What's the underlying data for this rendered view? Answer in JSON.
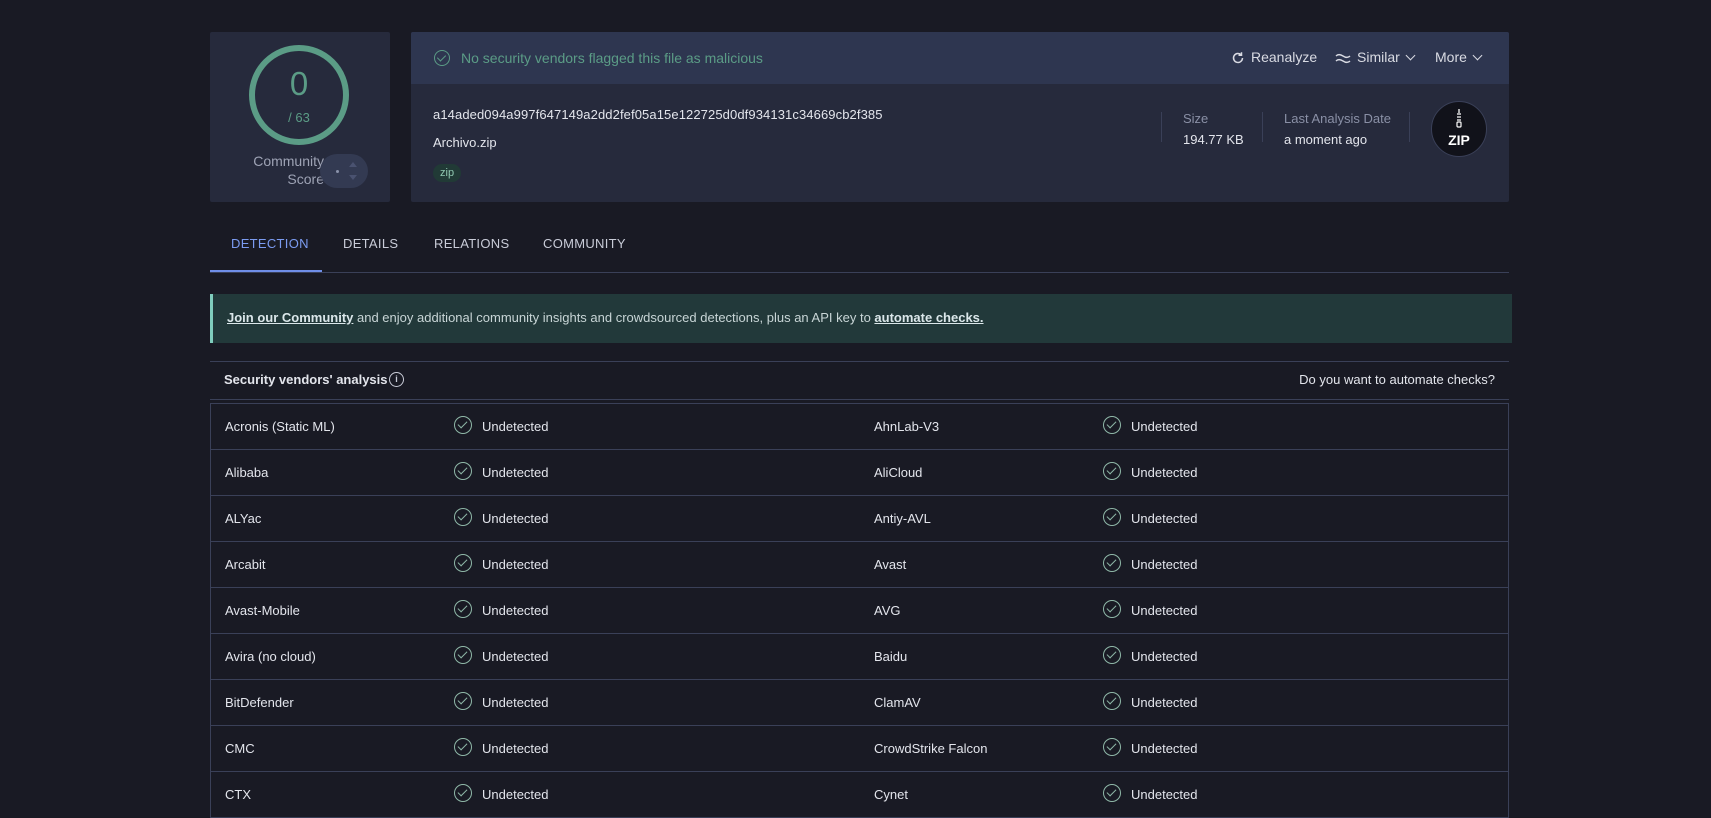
{
  "score": {
    "detections": "0",
    "total": "/ 63",
    "community_label": "Community Score",
    "community_value": "-"
  },
  "banner": {
    "message": "No security vendors flagged this file as malicious"
  },
  "toolbar": {
    "reanalyze": "Reanalyze",
    "similar": "Similar",
    "more": "More"
  },
  "file": {
    "hash": "a14aded094a997f647149a2dd2fef05a15e122725d0df934131c34669cb2f385",
    "name": "Archivo.zip",
    "tag": "zip",
    "size_label": "Size",
    "size_value": "194.77 KB",
    "date_label": "Last Analysis Date",
    "date_value": "a moment ago",
    "type_icon_label": "ZIP"
  },
  "tabs": [
    "DETECTION",
    "DETAILS",
    "RELATIONS",
    "COMMUNITY"
  ],
  "community_banner": {
    "link1": "Join our Community",
    "middle": " and enjoy additional community insights and crowdsourced detections, plus an API key to ",
    "link2": "automate checks."
  },
  "vendors": {
    "title": "Security vendors' analysis",
    "automate_prompt": "Do you want to automate checks?",
    "rows": [
      [
        {
          "name": "Acronis (Static ML)",
          "result": "Undetected"
        },
        {
          "name": "AhnLab-V3",
          "result": "Undetected"
        }
      ],
      [
        {
          "name": "Alibaba",
          "result": "Undetected"
        },
        {
          "name": "AliCloud",
          "result": "Undetected"
        }
      ],
      [
        {
          "name": "ALYac",
          "result": "Undetected"
        },
        {
          "name": "Antiy-AVL",
          "result": "Undetected"
        }
      ],
      [
        {
          "name": "Arcabit",
          "result": "Undetected"
        },
        {
          "name": "Avast",
          "result": "Undetected"
        }
      ],
      [
        {
          "name": "Avast-Mobile",
          "result": "Undetected"
        },
        {
          "name": "AVG",
          "result": "Undetected"
        }
      ],
      [
        {
          "name": "Avira (no cloud)",
          "result": "Undetected"
        },
        {
          "name": "Baidu",
          "result": "Undetected"
        }
      ],
      [
        {
          "name": "BitDefender",
          "result": "Undetected"
        },
        {
          "name": "ClamAV",
          "result": "Undetected"
        }
      ],
      [
        {
          "name": "CMC",
          "result": "Undetected"
        },
        {
          "name": "CrowdStrike Falcon",
          "result": "Undetected"
        }
      ],
      [
        {
          "name": "CTX",
          "result": "Undetected"
        },
        {
          "name": "Cynet",
          "result": "Undetected"
        }
      ]
    ]
  },
  "colors": {
    "clean": "#5b9c86",
    "accent": "#6f8ee8",
    "background": "#191a24",
    "card": "#262a3c"
  }
}
